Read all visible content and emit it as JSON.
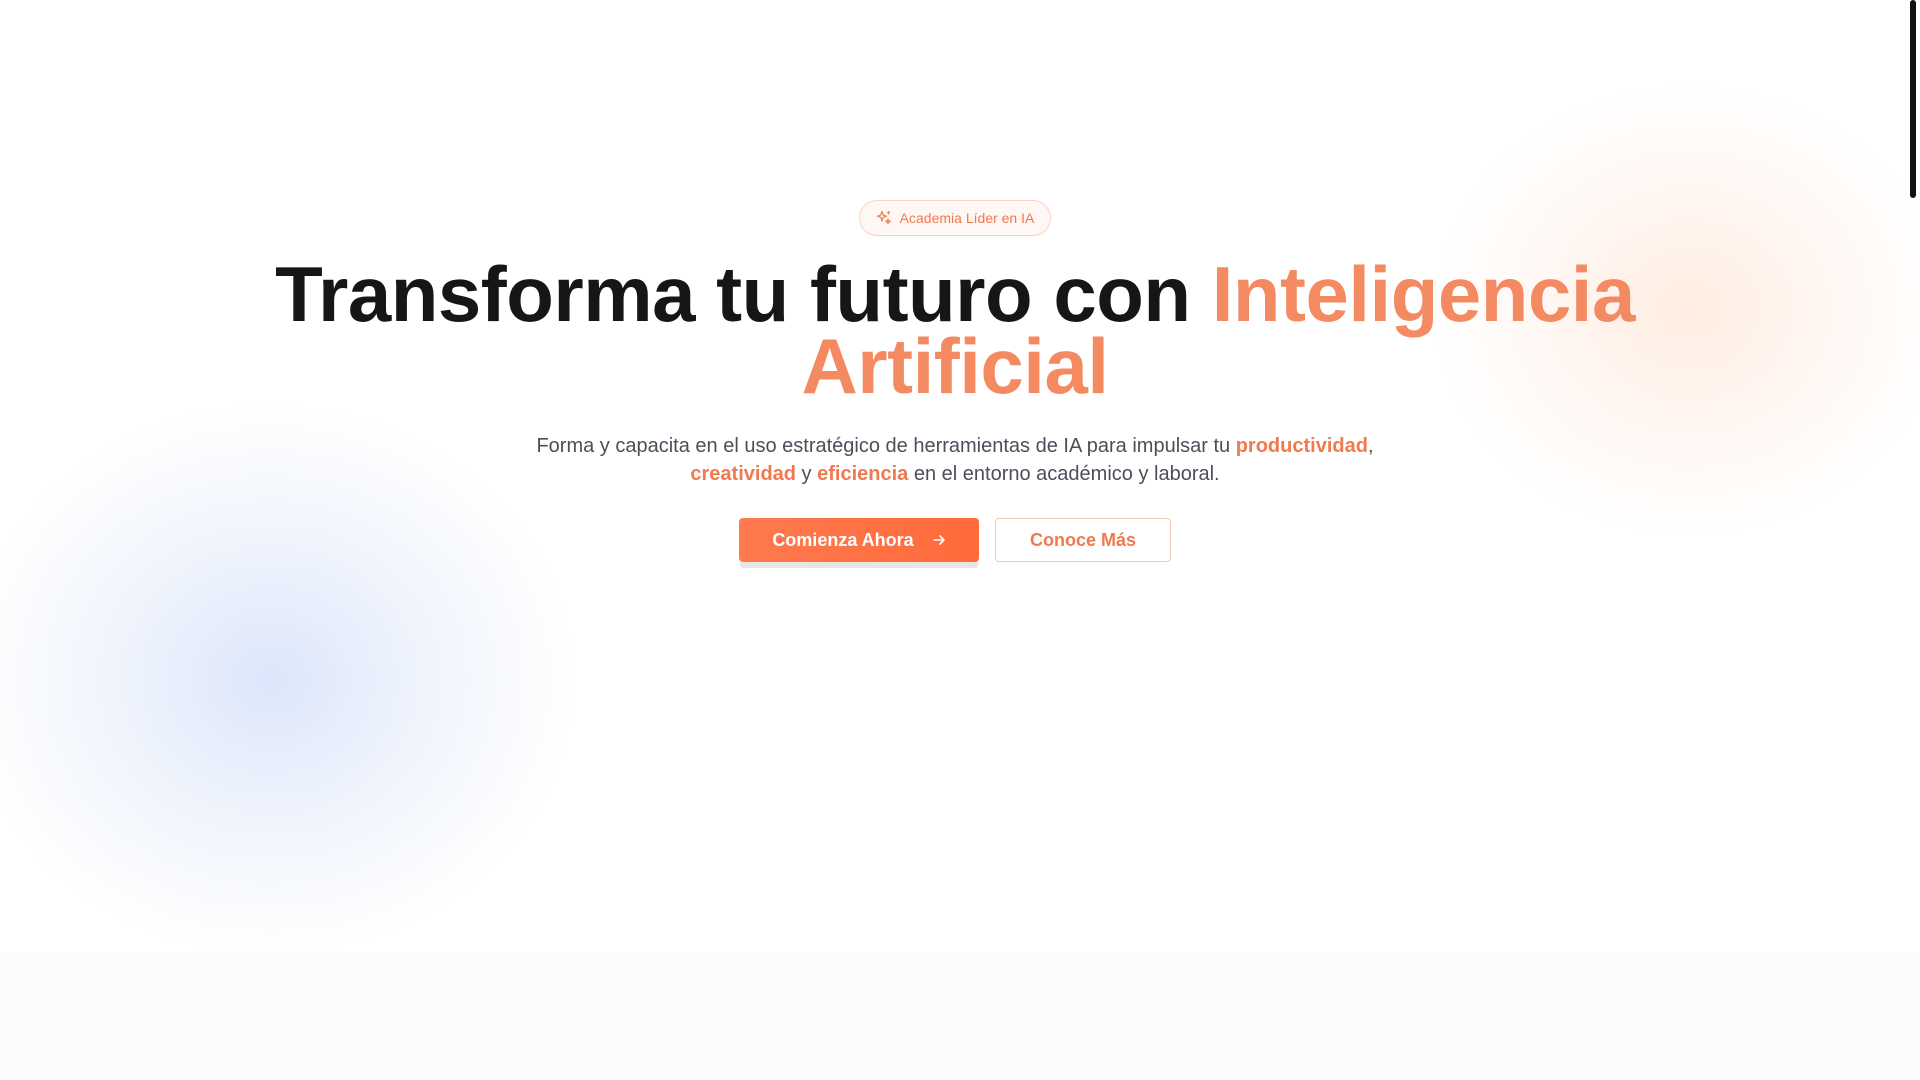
{
  "badge": {
    "icon": "sparkles-icon",
    "label": "Academia Líder en IA"
  },
  "hero": {
    "title_dark": "Transforma tu futuro con ",
    "title_accent_1": "Inteligencia",
    "title_accent_2": "Artificial",
    "subtitle_part1": "Forma y capacita en el uso estratégico de herramientas de IA para impulsar tu ",
    "subtitle_hl1": "productividad",
    "subtitle_part2": ",",
    "subtitle_hl2": "creatividad",
    "subtitle_part3": " y ",
    "subtitle_hl3": "eficiencia",
    "subtitle_part4": " en el entorno académico y laboral."
  },
  "actions": {
    "primary_label": "Comienza Ahora",
    "primary_icon": "arrow-right-icon",
    "secondary_label": "Conoce Más"
  },
  "colors": {
    "accent": "#f07a4e",
    "button": "#ff6a3a",
    "title": "#161616",
    "text": "#4a4f5a"
  }
}
